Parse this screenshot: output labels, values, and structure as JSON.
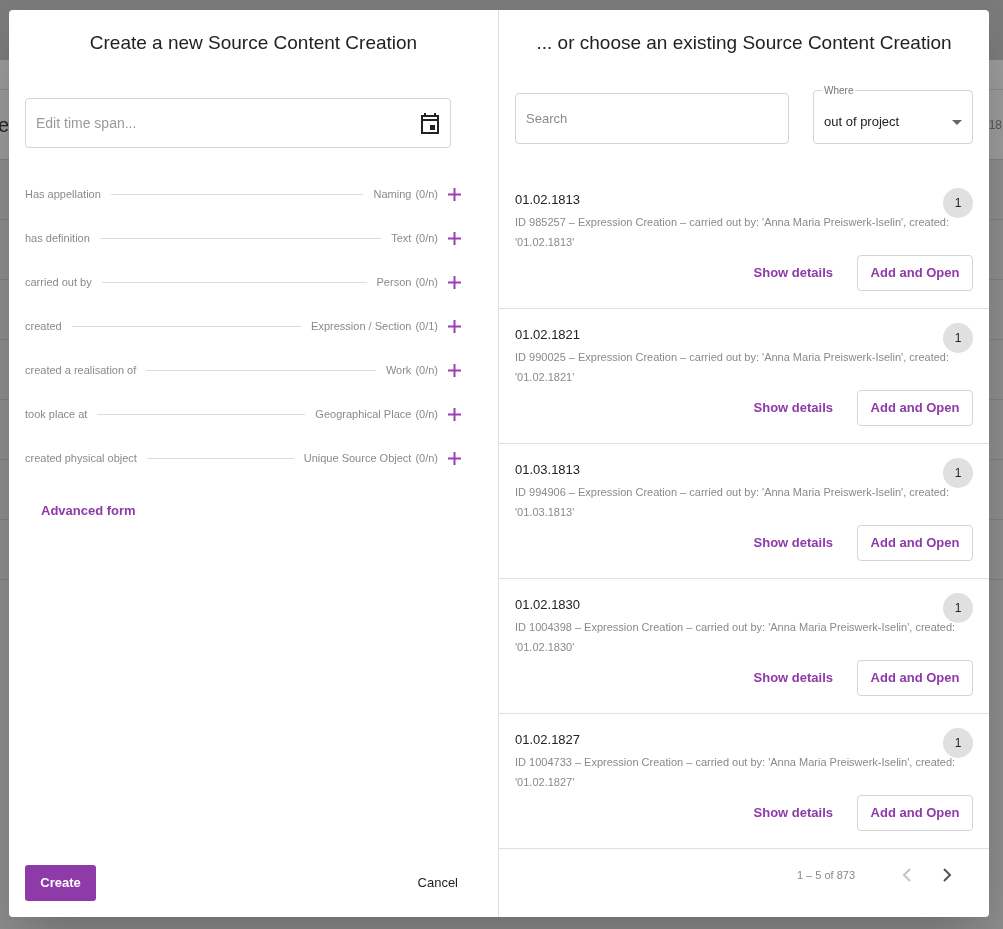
{
  "background_fragments": [
    {
      "text": "e"
    },
    {
      "text": "18"
    }
  ],
  "create_panel": {
    "title": "Create a new Source Content Creation",
    "time_span_field": {
      "placeholder": "Edit time span..."
    },
    "relations": [
      {
        "label": "Has appellation",
        "target": "Naming",
        "count": "(0/n)"
      },
      {
        "label": "has definition",
        "target": "Text",
        "count": "(0/n)"
      },
      {
        "label": "carried out by",
        "target": "Person",
        "count": "(0/n)"
      },
      {
        "label": "created",
        "target": "Expression / Section",
        "count": "(0/1)"
      },
      {
        "label": "created a realisation of",
        "target": "Work",
        "count": "(0/n)"
      },
      {
        "label": "took place at",
        "target": "Geographical Place",
        "count": "(0/n)"
      },
      {
        "label": "created physical object",
        "target": "Unique Source Object",
        "count": "(0/n)"
      }
    ],
    "advanced_link": "Advanced form",
    "create_button": "Create",
    "cancel_button": "Cancel"
  },
  "choose_panel": {
    "title": "... or choose an existing Source Content Creation",
    "search": {
      "placeholder": "Search"
    },
    "where_select": {
      "label": "Where",
      "value": "out of project"
    },
    "results": [
      {
        "date": "01.02.1813",
        "badge": "1",
        "description": "ID 985257 – Expression Creation – carried out by: 'Anna Maria Preiswerk-Iselin', created: '01.02.1813'",
        "details_link": "Show details",
        "add_button": "Add and Open"
      },
      {
        "date": "01.02.1821",
        "badge": "1",
        "description": "ID 990025 – Expression Creation – carried out by: 'Anna Maria Preiswerk-Iselin', created: '01.02.1821'",
        "details_link": "Show details",
        "add_button": "Add and Open"
      },
      {
        "date": "01.03.1813",
        "badge": "1",
        "description": "ID 994906 – Expression Creation – carried out by: 'Anna Maria Preiswerk-Iselin', created: '01.03.1813'",
        "details_link": "Show details",
        "add_button": "Add and Open"
      },
      {
        "date": "01.02.1830",
        "badge": "1",
        "description": "ID 1004398 – Expression Creation – carried out by: 'Anna Maria Preiswerk-Iselin', created: '01.02.1830'",
        "details_link": "Show details",
        "add_button": "Add and Open"
      },
      {
        "date": "01.02.1827",
        "badge": "1",
        "description": "ID 1004733 – Expression Creation – carried out by: 'Anna Maria Preiswerk-Iselin', created: '01.02.1827'",
        "details_link": "Show details",
        "add_button": "Add and Open"
      }
    ],
    "pagination": {
      "range": "1 – 5 of 873",
      "previous_disabled": true,
      "next_disabled": false
    }
  }
}
